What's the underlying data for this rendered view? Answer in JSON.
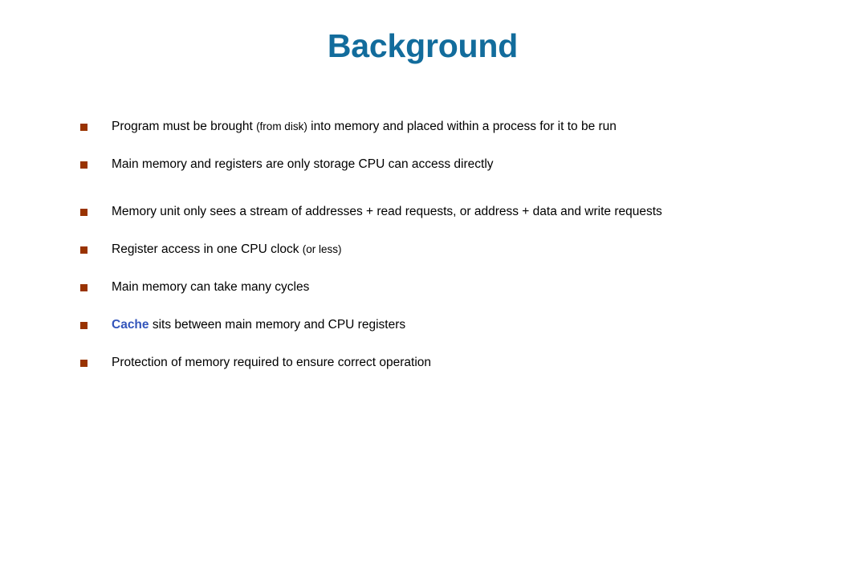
{
  "slide": {
    "title": "Background",
    "title_color": "#126C9C",
    "bullet_color": "#993300",
    "text_color": "#000000",
    "highlight_color": "#3355BB",
    "background_color": "#ffffff",
    "bullets": [
      {
        "id": "program-brought-into-memory",
        "parts": [
          {
            "text": "Program must be brought ",
            "style": "normal"
          },
          {
            "text": "(from disk)",
            "style": "small"
          },
          {
            "text": "  into memory and placed within a process for it to be run",
            "style": "normal"
          }
        ],
        "plain": "Program must be brought (from disk)  into memory and placed within a process for it to be run",
        "spacing_after": "normal"
      },
      {
        "id": "main-memory-registers-direct-access",
        "parts": [
          {
            "text": "Main memory and registers are only storage CPU can access directly",
            "style": "normal"
          }
        ],
        "plain": "Main memory and registers are only storage CPU can access directly",
        "spacing_after": "large"
      },
      {
        "id": "memory-unit-stream-of-addresses",
        "parts": [
          {
            "text": "Memory unit only sees a stream of addresses + read requests, or address + data and write requests",
            "style": "normal"
          }
        ],
        "plain": "Memory unit only sees a stream of addresses + read requests, or address + data and write requests",
        "spacing_after": "normal"
      },
      {
        "id": "register-access-one-cpu-clock",
        "parts": [
          {
            "text": "Register access in one CPU clock ",
            "style": "normal"
          },
          {
            "text": "(or less)",
            "style": "small"
          }
        ],
        "plain": "Register access in one CPU clock (or less)",
        "spacing_after": "normal"
      },
      {
        "id": "main-memory-many-cycles",
        "parts": [
          {
            "text": "Main memory can take many cycles",
            "style": "normal"
          }
        ],
        "plain": "Main memory can take many cycles",
        "spacing_after": "normal"
      },
      {
        "id": "cache-sits-between",
        "parts": [
          {
            "text": "Cache",
            "style": "highlight"
          },
          {
            "text": " sits between main memory and CPU registers",
            "style": "normal"
          }
        ],
        "plain": "Cache sits between main memory and CPU registers",
        "spacing_after": "normal"
      },
      {
        "id": "protection-of-memory",
        "parts": [
          {
            "text": "Protection of memory required to ensure correct operation",
            "style": "normal"
          }
        ],
        "plain": "Protection of memory required to ensure correct operation",
        "spacing_after": "none"
      }
    ]
  }
}
